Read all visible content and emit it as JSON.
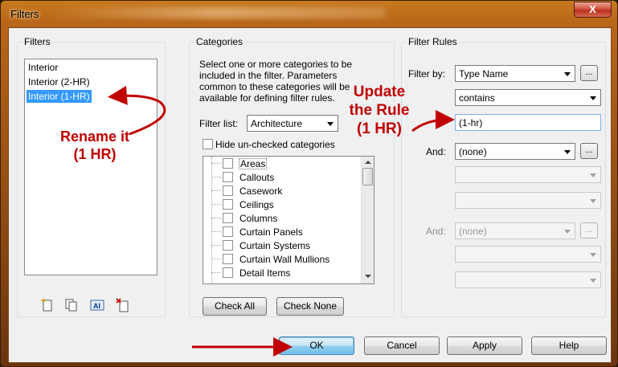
{
  "window": {
    "title": "Filters",
    "close_glyph": "X"
  },
  "filters_panel": {
    "label": "Filters",
    "items": [
      {
        "label": "Interior",
        "selected": false
      },
      {
        "label": "Interior (2-HR)",
        "selected": false
      },
      {
        "label": "Interior (1-HR)",
        "selected": true
      }
    ],
    "icons": [
      "new-filter-icon",
      "duplicate-filter-icon",
      "rename-filter-icon",
      "delete-filter-icon"
    ]
  },
  "categories_panel": {
    "label": "Categories",
    "description": "Select one or more categories to be included in the filter.  Parameters common to these categories will be available for defining filter rules.",
    "filter_list_label": "Filter list:",
    "filter_list_value": "Architecture",
    "hide_unchecked_label": "Hide un-checked categories",
    "items": [
      "Areas",
      "Callouts",
      "Casework",
      "Ceilings",
      "Columns",
      "Curtain Panels",
      "Curtain Systems",
      "Curtain Wall Mullions",
      "Detail Items"
    ],
    "check_all_label": "Check All",
    "check_none_label": "Check None"
  },
  "rules_panel": {
    "label": "Filter Rules",
    "filter_by_label": "Filter by:",
    "filter_by_value": "Type Name",
    "operator_value": "contains",
    "rule_value": "(1-hr)",
    "and1_label": "And:",
    "and1_value": "(none)",
    "and2_label": "And:",
    "and2_value": "(none)",
    "ellipsis": "..."
  },
  "buttons": {
    "ok": "OK",
    "cancel": "Cancel",
    "apply": "Apply",
    "help": "Help"
  },
  "annotations": {
    "rename_line1": "Rename it",
    "rename_line2": "(1 HR)",
    "update_line1": "Update",
    "update_line2": "the Rule",
    "update_line3": "(1 HR)"
  },
  "colors": {
    "annotation": "#c00000",
    "selection": "#3399ff",
    "frame": "#b8661a"
  }
}
